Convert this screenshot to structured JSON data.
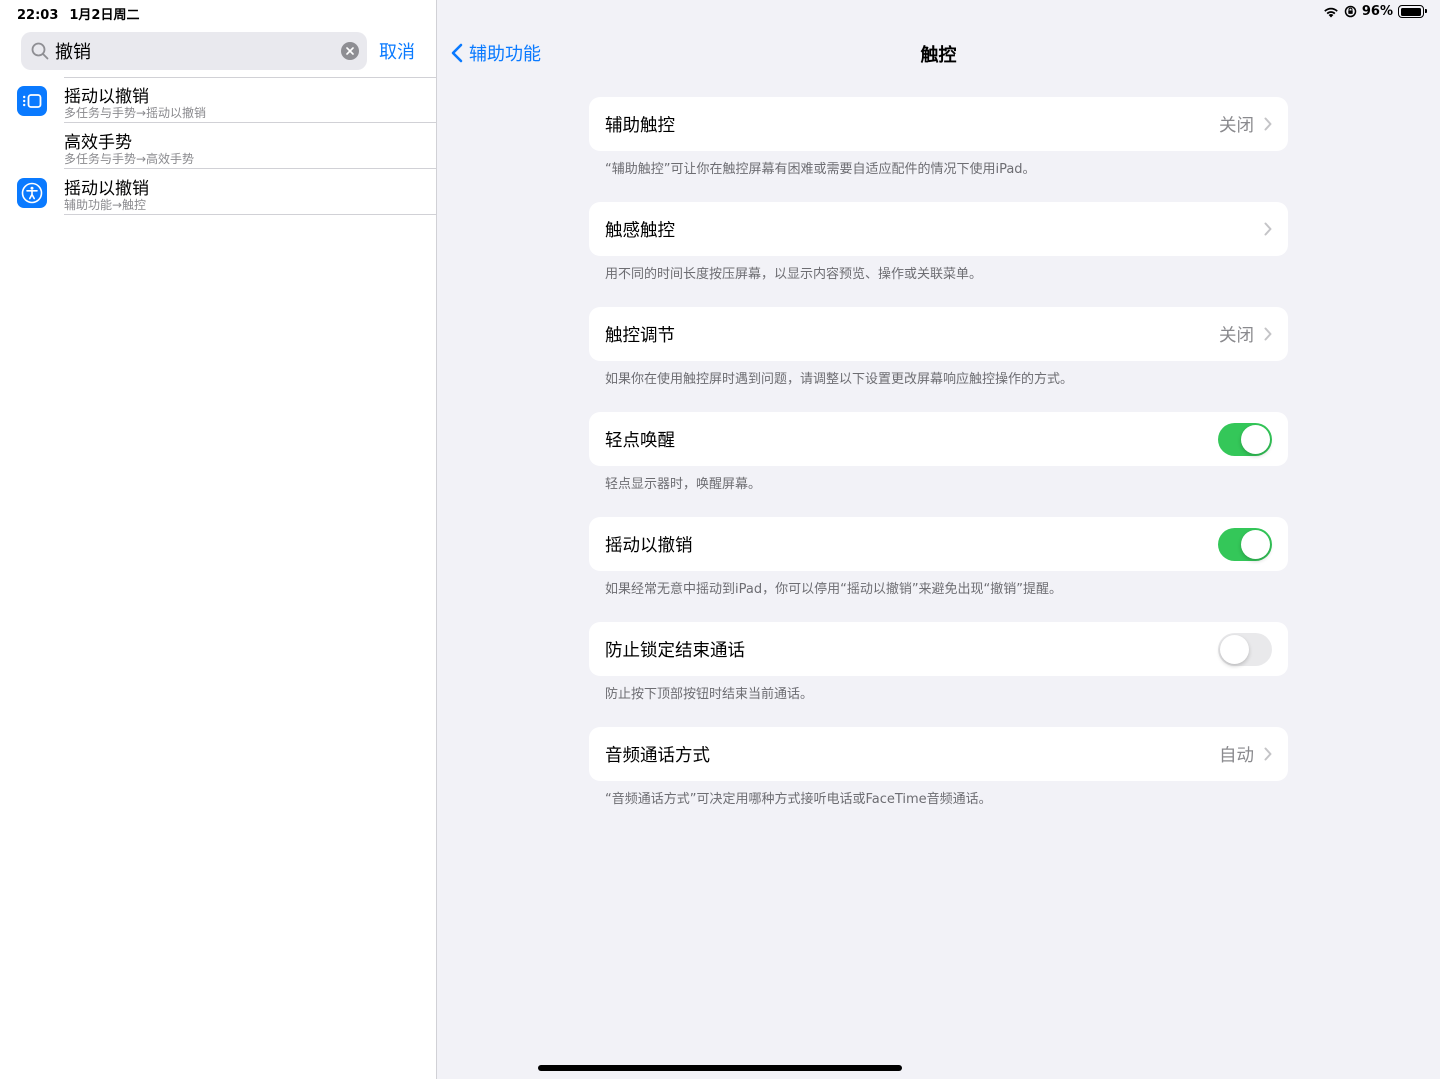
{
  "status": {
    "time": "22:03",
    "date": "1月2日周二",
    "battery": "96%",
    "battery_level": 0.96
  },
  "search": {
    "value": "撤销",
    "cancel_label": "取消"
  },
  "results": [
    {
      "title": "摇动以撤销",
      "path": "多任务与手势→摇动以撤销",
      "icon": "multitasking-icon"
    },
    {
      "title": "高效手势",
      "path": "多任务与手势→高效手势",
      "icon": ""
    },
    {
      "title": "摇动以撤销",
      "path": "辅助功能→触控",
      "icon": "accessibility-icon"
    }
  ],
  "nav": {
    "back_label": "辅助功能",
    "title": "触控"
  },
  "settings": [
    {
      "label": "辅助触控",
      "value": "关闭",
      "type": "link",
      "footer": "“辅助触控”可让你在触控屏幕有困难或需要自适应配件的情况下使用iPad。"
    },
    {
      "label": "触感触控",
      "value": "",
      "type": "link",
      "footer": "用不同的时间长度按压屏幕，以显示内容预览、操作或关联菜单。"
    },
    {
      "label": "触控调节",
      "value": "关闭",
      "type": "link",
      "footer": "如果你在使用触控屏时遇到问题，请调整以下设置更改屏幕响应触控操作的方式。"
    },
    {
      "label": "轻点唤醒",
      "type": "toggle",
      "on": true,
      "footer": "轻点显示器时，唤醒屏幕。"
    },
    {
      "label": "摇动以撤销",
      "type": "toggle",
      "on": true,
      "footer": "如果经常无意中摇动到iPad，你可以停用“摇动以撤销”来避免出现“撤销”提醒。"
    },
    {
      "label": "防止锁定结束通话",
      "type": "toggle",
      "on": false,
      "footer": "防止按下顶部按钮时结束当前通话。"
    },
    {
      "label": "音频通话方式",
      "value": "自动",
      "type": "link",
      "footer": "“音频通话方式”可决定用哪种方式接听电话或FaceTime音频通话。"
    }
  ],
  "colors": {
    "accent": "#0a7aff",
    "toggle_on": "#34c759",
    "toggle_off": "#e9e9eb",
    "background": "#f2f2f7"
  }
}
